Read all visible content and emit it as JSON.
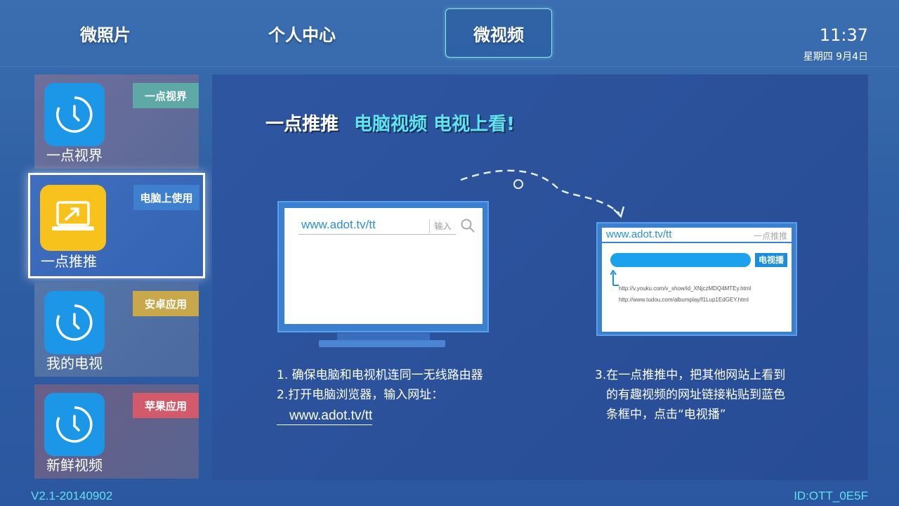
{
  "nav": {
    "tabs": [
      {
        "label": "微照片"
      },
      {
        "label": "个人中心"
      },
      {
        "label": "微视频"
      }
    ],
    "active": "微视频"
  },
  "status": {
    "time": "11:37",
    "date": "星期四 9月4日"
  },
  "sidebar": {
    "items": [
      {
        "label": "一点视界",
        "tag": "一点视界",
        "tag_color": "#5fa8a8",
        "icon": "clock-icon"
      },
      {
        "label": "一点推推",
        "tag": "电脑上使用",
        "tag_color": "#3f7fcf",
        "icon": "laptop-share-icon"
      },
      {
        "label": "我的电视",
        "tag": "安卓应用",
        "tag_color": "#c8a84a",
        "icon": "clock-icon"
      },
      {
        "label": "新鲜视频",
        "tag": "苹果应用",
        "tag_color": "#d25a6a",
        "icon": "clock-icon"
      }
    ]
  },
  "main": {
    "headline_white": "一点推推",
    "headline_cyan": "电脑视频 电视上看!",
    "monitor": {
      "url": "www.adot.tv/tt",
      "input_label": "输入"
    },
    "tv": {
      "url": "www.adot.tv/tt",
      "tag": "一点推推",
      "play_button": "电视播",
      "link1": "http://v.youku.com/v_show/id_XNjczMDQ4MTEy.html",
      "link2": "http://www.tudou.com/albumplay/f1Lup1EdGEY.html"
    },
    "instructions_left": {
      "line1": "1. 确保电脑和电视机连同一无线路由器",
      "line2": "2.打开电脑浏览器，输入网址：",
      "link": "www.adot.tv/tt"
    },
    "instructions_right": {
      "line1": "3.在一点推推中，把其他网站上看到",
      "line2": "的有趣视频的网址链接粘贴到蓝色",
      "line3": "条框中，点击“电视播”"
    }
  },
  "footer": {
    "version": "V2.1-20140902",
    "device_id": "ID:OTT_0E5F"
  },
  "colors": {
    "accent_cyan": "#5ee3f0",
    "background": "#2f5fa4",
    "focus_border": "#ffffff"
  }
}
